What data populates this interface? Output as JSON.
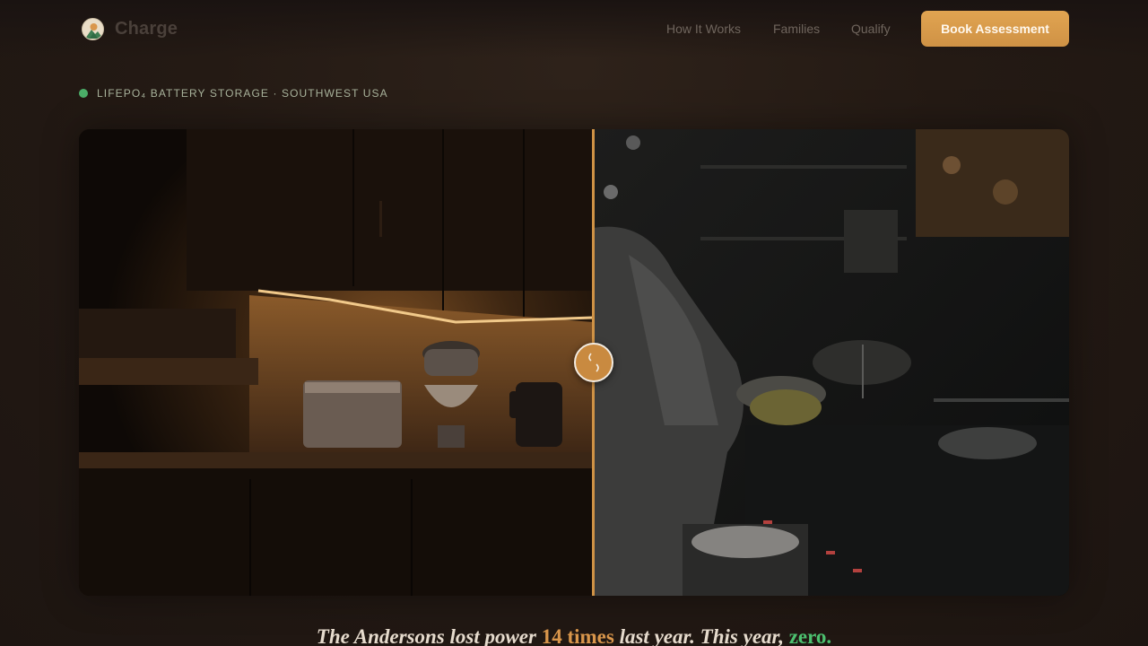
{
  "brand": {
    "name": "Charge",
    "logo_icon": "sun-mountain-icon"
  },
  "nav": {
    "links": [
      "How It Works",
      "Families",
      "Qualify"
    ],
    "cta_label": "Book Assessment"
  },
  "eyebrow": {
    "text": "LIFEPO₄ BATTERY STORAGE · SOUTHWEST USA",
    "status_color": "#4caf69"
  },
  "comparison": {
    "left_scene": "kitchen-lit-by-battery-image",
    "right_scene": "dark-kitchen-outage-image",
    "handle_icon": "drag-handle-icon"
  },
  "headline": {
    "part1": "The Andersons lost power ",
    "highlight": "14 times",
    "part2": " last year. This year, ",
    "zero": "zero."
  },
  "colors": {
    "accent": "#cf9245",
    "success": "#4cc06f",
    "background": "#241a14"
  }
}
